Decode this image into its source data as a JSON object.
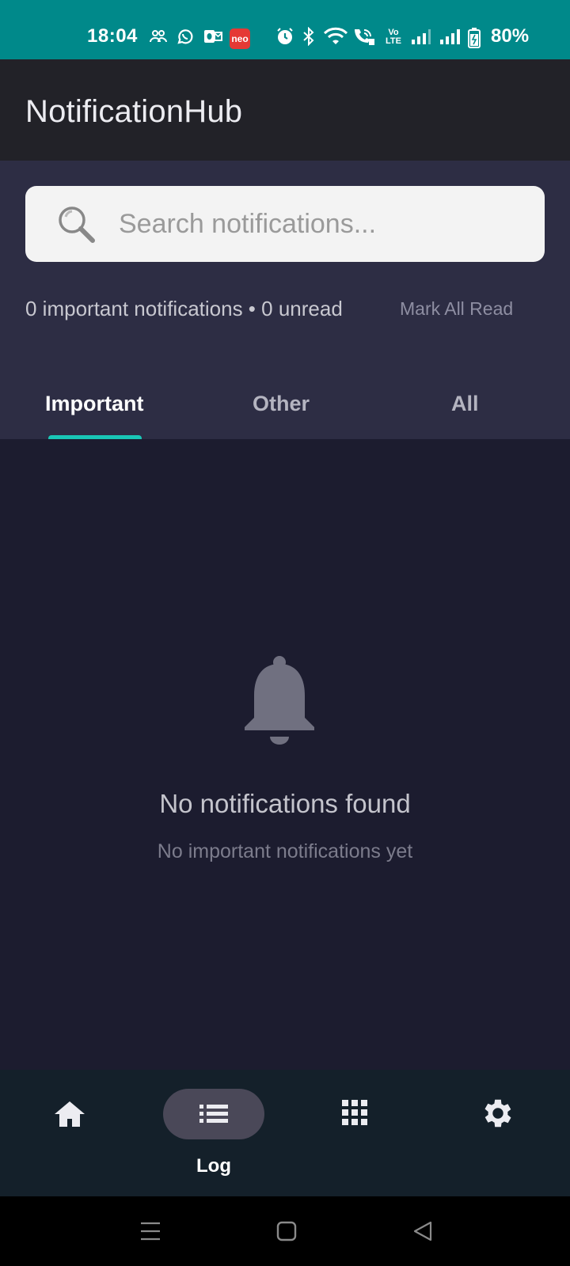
{
  "status_bar": {
    "time": "18:04",
    "battery": "80%",
    "icons": [
      "people-icon",
      "whatsapp-icon",
      "outlook-icon",
      "neo-app-icon",
      "alarm-icon",
      "bluetooth-icon",
      "wifi-icon",
      "wifi-calling-icon",
      "volte-icon",
      "signal-icon",
      "signal-icon",
      "battery-icon"
    ],
    "neo_label": "neo",
    "volte_label": "Vo LTE"
  },
  "app_bar": {
    "title": "NotificationHub"
  },
  "search": {
    "placeholder": "Search notifications..."
  },
  "summary": {
    "text": "0 important notifications • 0 unread",
    "mark_all_label": "Mark All Read"
  },
  "tabs": [
    {
      "label": "Important",
      "active": true
    },
    {
      "label": "Other",
      "active": false
    },
    {
      "label": "All",
      "active": false
    }
  ],
  "empty_state": {
    "icon": "bell-icon",
    "title": "No notifications found",
    "subtitle": "No important notifications yet"
  },
  "bottom_nav": {
    "items": [
      {
        "icon": "home-icon",
        "label": "",
        "active": false
      },
      {
        "icon": "list-icon",
        "label": "Log",
        "active": true
      },
      {
        "icon": "grid-icon",
        "label": "",
        "active": false
      },
      {
        "icon": "gear-icon",
        "label": "",
        "active": false
      }
    ]
  },
  "system_nav": {
    "icons": [
      "menu-icon",
      "home-square-icon",
      "back-icon"
    ]
  },
  "colors": {
    "status_bar": "#00898a",
    "app_bar": "#222228",
    "header_panel": "#2d2d44",
    "content": "#1c1c2f",
    "accent": "#19c6b6",
    "bottom_nav": "#14202a"
  }
}
